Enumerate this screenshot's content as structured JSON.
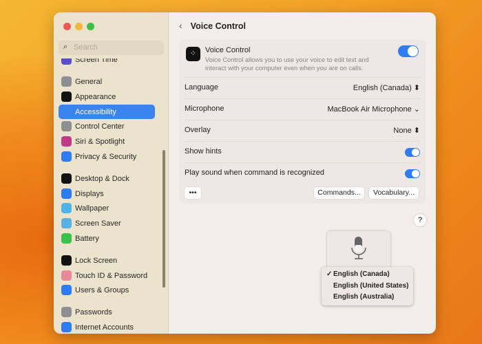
{
  "sidebar": {
    "search_placeholder": "Search",
    "items": [
      {
        "label": "Screen Time",
        "icon": "hourglass-icon",
        "color": "#5b4fc8"
      },
      {
        "label": "General",
        "icon": "gear-icon",
        "color": "#8e8e93"
      },
      {
        "label": "Appearance",
        "icon": "appearance-icon",
        "color": "#111111"
      },
      {
        "label": "Accessibility",
        "icon": "accessibility-icon",
        "color": "#3b84f0"
      },
      {
        "label": "Control Center",
        "icon": "control-center-icon",
        "color": "#8e8e93"
      },
      {
        "label": "Siri & Spotlight",
        "icon": "siri-icon",
        "color": "#c03a8a"
      },
      {
        "label": "Privacy & Security",
        "icon": "hand-icon",
        "color": "#2f7bf0"
      },
      {
        "label": "Desktop & Dock",
        "icon": "dock-icon",
        "color": "#111111"
      },
      {
        "label": "Displays",
        "icon": "sun-icon",
        "color": "#2f7bf0"
      },
      {
        "label": "Wallpaper",
        "icon": "flower-icon",
        "color": "#4fb5e8"
      },
      {
        "label": "Screen Saver",
        "icon": "screen-saver-icon",
        "color": "#5ab0e0"
      },
      {
        "label": "Battery",
        "icon": "battery-icon",
        "color": "#3cc24a"
      },
      {
        "label": "Lock Screen",
        "icon": "lock-icon",
        "color": "#111111"
      },
      {
        "label": "Touch ID & Password",
        "icon": "fingerprint-icon",
        "color": "#e88a9a"
      },
      {
        "label": "Users & Groups",
        "icon": "users-icon",
        "color": "#2f7bf0"
      },
      {
        "label": "Passwords",
        "icon": "key-icon",
        "color": "#8e8e93"
      },
      {
        "label": "Internet Accounts",
        "icon": "at-icon",
        "color": "#2f7bf0"
      }
    ]
  },
  "header": {
    "back": "‹",
    "title": "Voice Control"
  },
  "voice_control": {
    "title": "Voice Control",
    "description": "Voice Control allows you to use your voice to edit text and interact with your computer even when you are on calls.",
    "enabled": true
  },
  "rows": [
    {
      "label": "Language",
      "value": "English (Canada) ⬍"
    },
    {
      "label": "Microphone",
      "value": "MacBook Air Microphone ⌄"
    },
    {
      "label": "Overlay",
      "value": "None ⬍"
    },
    {
      "label": "Show hints",
      "toggle": true
    },
    {
      "label": "Play sound when command is recognized",
      "toggle": true
    }
  ],
  "buttons": {
    "more": "•••",
    "commands": "Commands...",
    "vocabulary": "Vocabulary...",
    "help": "?"
  },
  "language_menu": {
    "checkmark": "✓",
    "options": [
      "English (Canada)",
      "English (United States)",
      "English (Australia)"
    ],
    "selected": "English (Canada)"
  }
}
